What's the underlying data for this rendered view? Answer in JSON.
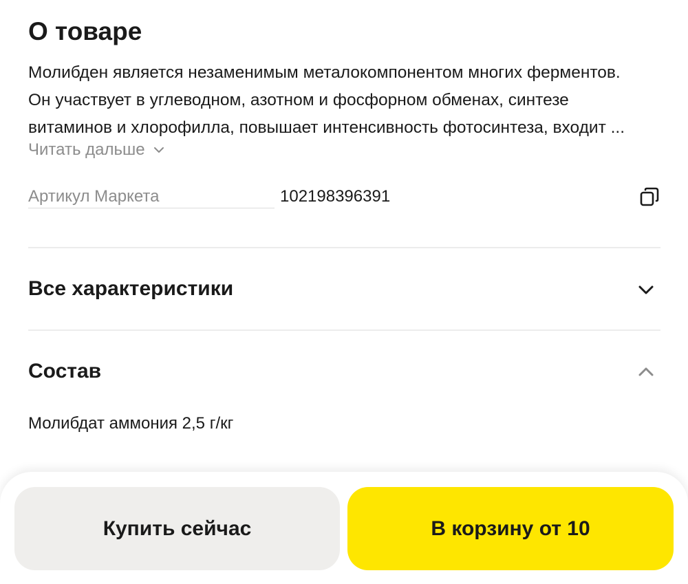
{
  "about": {
    "title": "О товаре",
    "description_lines": [
      "Молибден является незаменимым металокомпонентом многих ферментов.",
      "Он участвует в углеводном, азотном и фосфорном обменах, синтезе",
      "витаминов и хлорофилла, повышает интенсивность фотосинтеза, входит ..."
    ],
    "read_more_label": "Читать дальше",
    "read_more_icon": "chevron-down-icon"
  },
  "sku": {
    "label": "Артикул Маркета",
    "value": "102198396391",
    "copy_icon": "copy-icon"
  },
  "accordions": [
    {
      "title": "Все характеристики",
      "icon": "chevron-down-icon",
      "expanded": false
    },
    {
      "title": "Состав",
      "icon": "chevron-up-icon",
      "expanded": true
    }
  ],
  "composition": {
    "text": "Молибдат аммония 2,5 г/кг"
  },
  "actions": {
    "buy_now_label": "Купить сейчас",
    "add_to_cart_label": "В корзину от 10"
  },
  "colors": {
    "accent_yellow": "#fee600",
    "secondary_button": "#efeeec",
    "muted_text": "#8c8c8c"
  }
}
